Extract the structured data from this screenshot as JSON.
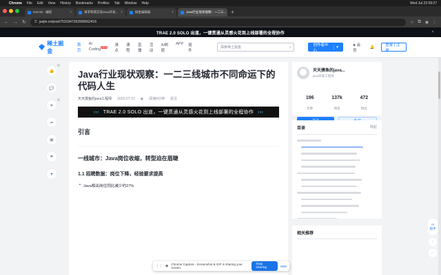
{
  "menubar": {
    "apple": "",
    "app": "Chrome",
    "items": [
      "File",
      "Edit",
      "View",
      "History",
      "Bookmarks",
      "Profiles",
      "Tab",
      "Window",
      "Help"
    ],
    "clock": "Wed Jul 23 09:27"
  },
  "tabs": [
    {
      "title": "Gemini - 编程",
      "active": false
    },
    {
      "title": "请求帮我实现Java开发...",
      "active": false
    },
    {
      "title": "掘金编辑器",
      "active": false
    },
    {
      "title": "Java行业现状观察：一二三...",
      "active": true
    }
  ],
  "address": {
    "url": "juejin.cn/post/7531947263990562416"
  },
  "promo": {
    "text": "TRAE 2.0 SOLO 出道，一键贯通从灵感火花到上线部署的全程协作",
    "close": "×"
  },
  "header": {
    "logo": "稀土掘金",
    "nav": [
      "首页",
      "AI Coding",
      "沸点",
      "课程",
      "直播",
      "活动",
      "AI刷题",
      "APP",
      "插件"
    ],
    "nav_badge": "NEW",
    "search_placeholder": "探索稀土掘金",
    "creator_label": "创作者中心",
    "notify": "会员",
    "bell": "",
    "login": "登录 | 注册"
  },
  "actions": [
    {
      "icon": "like-icon",
      "glyph": "👍",
      "badge": "3"
    },
    {
      "icon": "comment-icon",
      "glyph": "💬",
      "badge": ""
    },
    {
      "icon": "star-icon",
      "glyph": "★",
      "badge": "4"
    },
    {
      "icon": "share-icon",
      "glyph": "➦",
      "badge": ""
    },
    {
      "icon": "image-icon",
      "glyph": "▣",
      "badge": ""
    },
    {
      "icon": "report-icon",
      "glyph": "⚑",
      "badge": ""
    },
    {
      "icon": "ai-icon",
      "glyph": "✦",
      "badge": ""
    }
  ],
  "article": {
    "title": "Java行业现状观察：一二三线城市不同命运下的代码人生",
    "author": "天天摸鱼的java工程师",
    "date": "2025-07-23",
    "views": "",
    "read_time": "阅读8分钟",
    "follow": "关注",
    "banner_left": "‹‹‹",
    "banner_text": "TRAE 2.0 SOLO 出道，一键贯通从灵感火花到上线部署的全程协作",
    "banner_right": "›››",
    "intro_heading": "引言",
    "intro_p1": "",
    "intro_p2": "",
    "section1_heading": "一线城市：Java岗位收缩，转型迫在眉睫",
    "sub1_heading": "1.1 招聘数据：岗位下降，经验要求提高",
    "sub1_p": "",
    "bullet1": "Java相关岗位同比减少约27%"
  },
  "author_card": {
    "name": "天天摸鱼的java...",
    "subtitle": "java开发工程师",
    "badge": "",
    "stats": [
      {
        "value": "196",
        "label": "文章"
      },
      {
        "value": "137k",
        "label": "阅读"
      },
      {
        "value": "472",
        "label": "粉丝"
      }
    ],
    "follow_btn": "关注",
    "message_btn": "私信"
  },
  "toc": {
    "title": "目录",
    "collapse": "收起",
    "lines": 13
  },
  "related": {
    "title": "相关推荐",
    "items": [
      {
        "title": "",
        "meta": ""
      },
      {
        "title": "",
        "meta": ""
      }
    ]
  },
  "right_float": {
    "ai": "AI\n助手",
    "top": "",
    "more": ""
  },
  "sharebar": {
    "text": "Chrome Capture - Screenshot & GIF is sharing your screen.",
    "stop": "Stop sharing",
    "hide": "Hide"
  },
  "colors": {
    "brand": "#1e80ff",
    "dark": "#0d1117",
    "bg": "#f2f3f5"
  }
}
